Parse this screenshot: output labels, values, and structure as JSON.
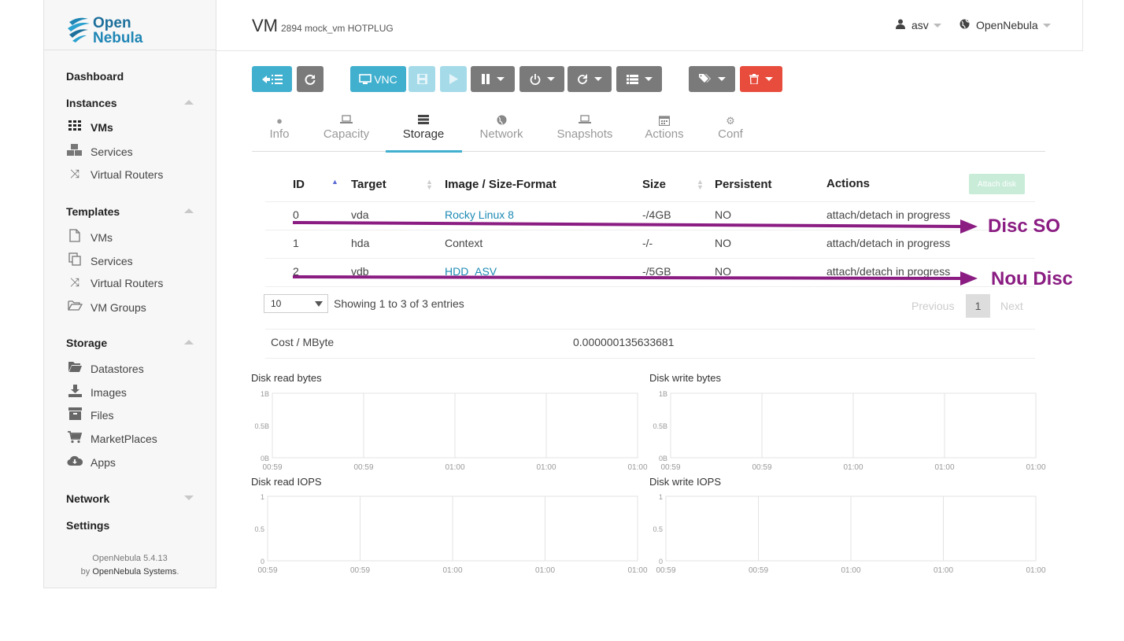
{
  "brand": {
    "line1": "Open",
    "line2": "Nebula"
  },
  "sidebar": {
    "dashboard": "Dashboard",
    "instances": {
      "label": "Instances",
      "items": [
        {
          "label": "VMs",
          "icon": "grid-icon"
        },
        {
          "label": "Services",
          "icon": "cubes-icon"
        },
        {
          "label": "Virtual Routers",
          "icon": "random-icon"
        }
      ]
    },
    "templates": {
      "label": "Templates",
      "items": [
        {
          "label": "VMs",
          "icon": "file-icon"
        },
        {
          "label": "Services",
          "icon": "copy-icon"
        },
        {
          "label": "Virtual Routers",
          "icon": "random-icon"
        },
        {
          "label": "VM Groups",
          "icon": "folder-open-icon"
        }
      ]
    },
    "storage": {
      "label": "Storage",
      "items": [
        {
          "label": "Datastores",
          "icon": "folder-icon"
        },
        {
          "label": "Images",
          "icon": "download-icon"
        },
        {
          "label": "Files",
          "icon": "archive-icon"
        },
        {
          "label": "MarketPlaces",
          "icon": "cart-icon"
        },
        {
          "label": "Apps",
          "icon": "cloud-download-icon"
        }
      ]
    },
    "network": "Network",
    "settings": "Settings",
    "footer": {
      "version": "OpenNebula 5.4.13",
      "by": "by",
      "company": "OpenNebula Systems",
      "dot": "."
    }
  },
  "header": {
    "title": "VM",
    "subtitle": "2894 mock_vm HOTPLUG",
    "user": "asv",
    "zone": "OpenNebula"
  },
  "toolbar": {
    "vnc_label": "VNC"
  },
  "tabs": [
    {
      "label": "Info",
      "icon": "info-icon"
    },
    {
      "label": "Capacity",
      "icon": "laptop-icon"
    },
    {
      "label": "Storage",
      "icon": "server-icon"
    },
    {
      "label": "Network",
      "icon": "globe-icon"
    },
    {
      "label": "Snapshots",
      "icon": "laptop-icon"
    },
    {
      "label": "Actions",
      "icon": "calendar-icon"
    },
    {
      "label": "Conf",
      "icon": "cog-icon"
    }
  ],
  "disks": {
    "columns": [
      "ID",
      "Target",
      "Image / Size-Format",
      "Size",
      "Persistent",
      "Actions"
    ],
    "attach_label": "Attach disk",
    "rows": [
      {
        "id": "0",
        "target": "vda",
        "image": "Rocky Linux 8",
        "size": "-/4GB",
        "persistent": "NO",
        "actions": "attach/detach in progress"
      },
      {
        "id": "1",
        "target": "hda",
        "image": "Context",
        "size": "-/-",
        "persistent": "NO",
        "actions": "attach/detach in progress"
      },
      {
        "id": "2",
        "target": "vdb",
        "image": "HDD_ASV",
        "size": "-/5GB",
        "persistent": "NO",
        "actions": "attach/detach in progress"
      }
    ],
    "page_size": "10",
    "showing": "Showing 1 to 3 of 3 entries",
    "previous": "Previous",
    "current_page": "1",
    "next": "Next"
  },
  "annotations": {
    "arrow1": "Disc SO",
    "arrow2": "Nou Disc",
    "color": "#8a1c82"
  },
  "cost": {
    "label": "Cost / MByte",
    "value": "0.000000135633681"
  },
  "graphs": [
    {
      "title": "Disk read bytes",
      "yticks": [
        "1B",
        "0.5B",
        "0B"
      ],
      "xticks": [
        "00:59",
        "00:59",
        "01:00",
        "01:00",
        "01:00"
      ]
    },
    {
      "title": "Disk write bytes",
      "yticks": [
        "1B",
        "0.5B",
        "0B"
      ],
      "xticks": [
        "00:59",
        "00:59",
        "01:00",
        "01:00",
        "01:00"
      ]
    },
    {
      "title": "Disk read IOPS",
      "yticks": [
        "1",
        "0.5",
        "0"
      ],
      "xticks": [
        "00:59",
        "00:59",
        "01:00",
        "01:00",
        "01:00"
      ]
    },
    {
      "title": "Disk write IOPS",
      "yticks": [
        "1",
        "0.5",
        "0"
      ],
      "xticks": [
        "00:59",
        "00:59",
        "01:00",
        "01:00",
        "01:00"
      ]
    }
  ],
  "colors": {
    "accent": "#41b0cf",
    "danger": "#e74c3c",
    "link": "#1d8ab4"
  }
}
